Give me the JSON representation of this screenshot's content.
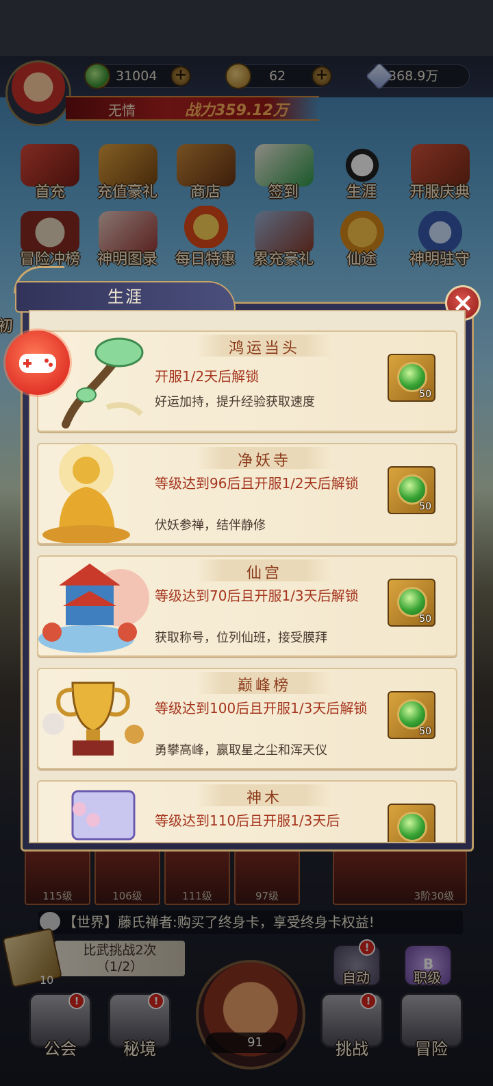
{
  "header": {
    "player_name": "无情",
    "power_label": "战力359.12万",
    "resources": [
      {
        "icon": "jade-coin-icon",
        "value": "31004"
      },
      {
        "icon": "gold-coin-icon",
        "value": "62"
      },
      {
        "icon": "crystal-icon",
        "value": "368.9万"
      }
    ]
  },
  "menu": {
    "row1": [
      "首充",
      "充值豪礼",
      "商店",
      "签到",
      "生涯",
      "开服庆典"
    ],
    "row2": [
      "冒险冲榜",
      "神明图录",
      "每日特惠",
      "累充豪礼",
      "仙途",
      "神明驻守"
    ],
    "partial_left": "初"
  },
  "modal": {
    "title": "生涯",
    "close_icon": "close-icon",
    "items": [
      {
        "name": "鸿运当头",
        "requirement": "开服1/2天后解锁",
        "description": "好运加持，提升经验获取速度",
        "reward_count": "50"
      },
      {
        "name": "净妖寺",
        "requirement": "等级达到96后且开服1/2天后解锁",
        "description": "伏妖参禅，结伴静修",
        "reward_count": "50"
      },
      {
        "name": "仙宫",
        "requirement": "等级达到70后且开服1/3天后解锁",
        "description": "获取称号，位列仙班，接受膜拜",
        "reward_count": "50"
      },
      {
        "name": "巅峰榜",
        "requirement": "等级达到100后且开服1/3天后解锁",
        "description": "勇攀高峰，赢取星之尘和浑天仪",
        "reward_count": "50"
      },
      {
        "name": "神木",
        "requirement": "等级达到110后且开服1/3天后",
        "description": "",
        "reward_count": ""
      }
    ]
  },
  "equipment_slots": {
    "levels": [
      "115级",
      "106级",
      "111级",
      "97级"
    ],
    "special": "3阶30级"
  },
  "chat": {
    "text": "【世界】藤氏禅者:购买了终身卡，享受终身卡权益!"
  },
  "challenge": {
    "line1": "比武挑战2次",
    "line2": "（1/2）",
    "card_count": "10"
  },
  "action": {
    "count": "91"
  },
  "side_buttons": {
    "auto": "自动",
    "rank": "职级",
    "rank_badge": "B"
  },
  "nav": {
    "guild": "公会",
    "secret": "秘境",
    "challenge": "挑战",
    "adventure": "冒险"
  },
  "alert_mark": "!"
}
